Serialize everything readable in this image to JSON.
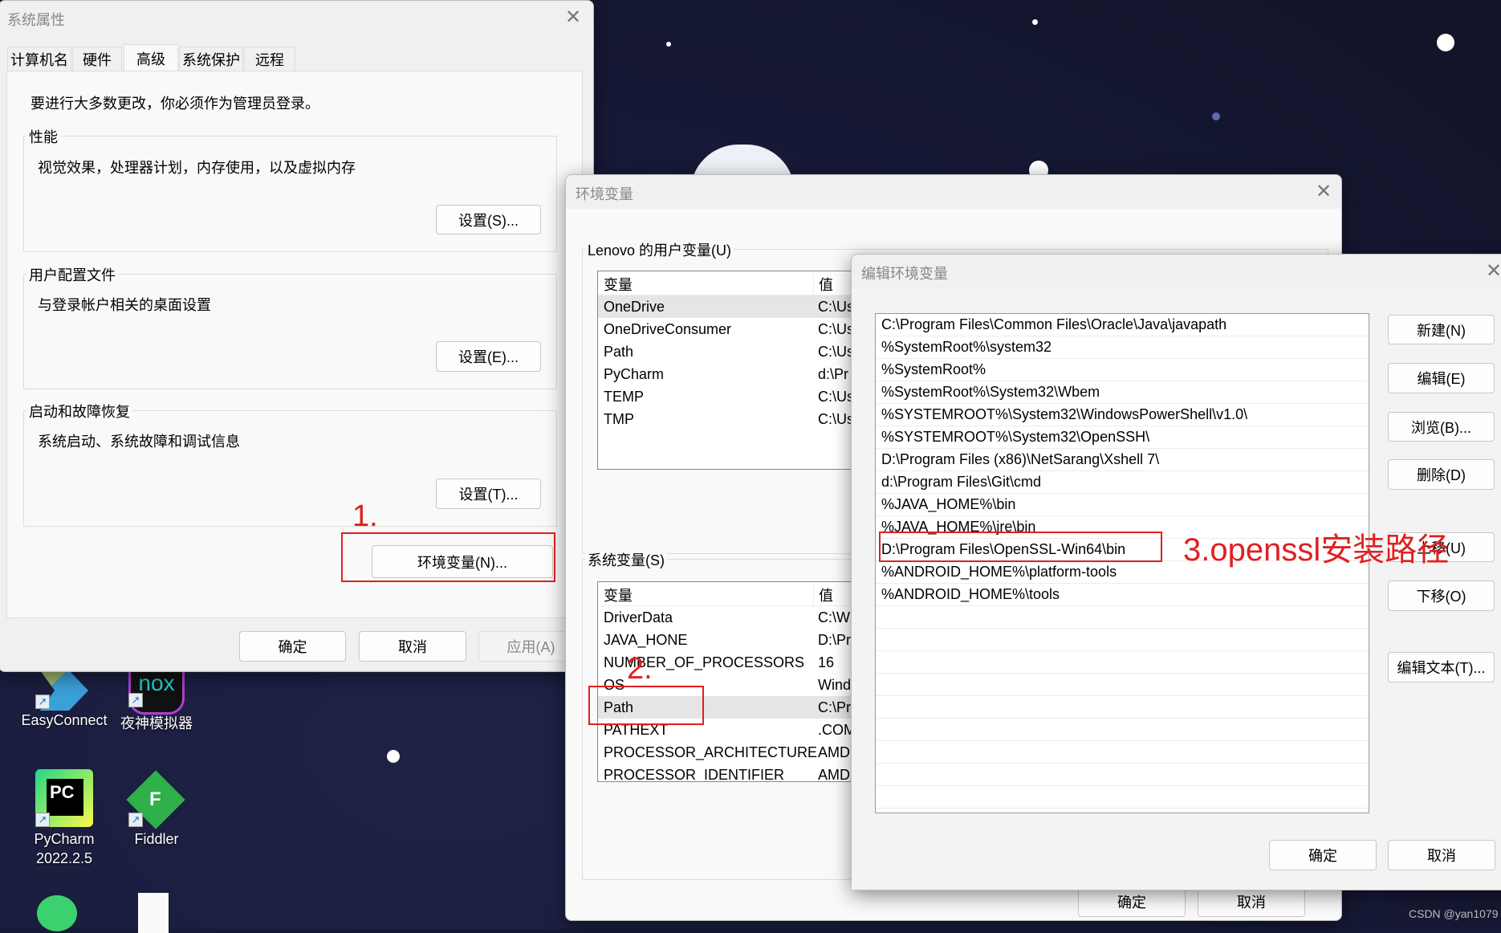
{
  "watermark": "CSDN @yan1079",
  "desktop": {
    "icons": [
      {
        "label": "EasyConnect"
      },
      {
        "label": "夜神模拟器",
        "logo": "nox"
      },
      {
        "label": "PyCharm\n2022.2.5",
        "label1": "PyCharm",
        "label2": "2022.2.5",
        "logo": "PC"
      },
      {
        "label": "Fiddler",
        "logo": "F"
      }
    ]
  },
  "system_properties": {
    "title": "系统属性",
    "tabs": [
      "计算机名",
      "硬件",
      "高级",
      "系统保护",
      "远程"
    ],
    "selected_tab": "高级",
    "notice": "要进行大多数更改，你必须作为管理员登录。",
    "groups": [
      {
        "label": "性能",
        "desc": "视觉效果，处理器计划，内存使用，以及虚拟内存",
        "button": "设置(S)..."
      },
      {
        "label": "用户配置文件",
        "desc": "与登录帐户相关的桌面设置",
        "button": "设置(E)..."
      },
      {
        "label": "启动和故障恢复",
        "desc": "系统启动、系统故障和调试信息",
        "button": "设置(T)..."
      }
    ],
    "env_button": "环境变量(N)...",
    "ok": "确定",
    "cancel": "取消",
    "apply": "应用(A)"
  },
  "environment_variables": {
    "title": "环境变量",
    "user_group": "Lenovo 的用户变量(U)",
    "system_group": "系统变量(S)",
    "col_var": "变量",
    "col_val": "值",
    "user_vars": [
      {
        "name": "OneDrive",
        "value": "C:\\Us"
      },
      {
        "name": "OneDriveConsumer",
        "value": "C:\\Us"
      },
      {
        "name": "Path",
        "value": "C:\\Us"
      },
      {
        "name": "PyCharm",
        "value": "d:\\Pr"
      },
      {
        "name": "TEMP",
        "value": "C:\\Us"
      },
      {
        "name": "TMP",
        "value": "C:\\Us"
      }
    ],
    "system_vars": [
      {
        "name": "DriverData",
        "value": "C:\\Wi"
      },
      {
        "name": "JAVA_HONE",
        "value": "D:\\Pr"
      },
      {
        "name": "NUMBER_OF_PROCESSORS",
        "value": "16"
      },
      {
        "name": "OS",
        "value": "Wind"
      },
      {
        "name": "Path",
        "value": "C:\\Pr"
      },
      {
        "name": "PATHEXT",
        "value": ".COM"
      },
      {
        "name": "PROCESSOR_ARCHITECTURE",
        "value": "AMD"
      },
      {
        "name": "PROCESSOR_IDENTIFIER",
        "value": "AMD"
      }
    ],
    "ok": "确定",
    "cancel": "取消"
  },
  "edit_env": {
    "title": "编辑环境变量",
    "entries": [
      "C:\\Program Files\\Common Files\\Oracle\\Java\\javapath",
      "%SystemRoot%\\system32",
      "%SystemRoot%",
      "%SystemRoot%\\System32\\Wbem",
      "%SYSTEMROOT%\\System32\\WindowsPowerShell\\v1.0\\",
      "%SYSTEMROOT%\\System32\\OpenSSH\\",
      "D:\\Program Files (x86)\\NetSarang\\Xshell 7\\",
      "d:\\Program Files\\Git\\cmd",
      "%JAVA_HOME%\\bin",
      "%JAVA_HOME%\\jre\\bin",
      "D:\\Program Files\\OpenSSL-Win64\\bin",
      "%ANDROID_HOME%\\platform-tools",
      "%ANDROID_HOME%\\tools"
    ],
    "buttons": {
      "new": "新建(N)",
      "edit": "编辑(E)",
      "browse": "浏览(B)...",
      "delete": "删除(D)",
      "up": "上移(U)",
      "down": "下移(O)",
      "edit_text": "编辑文本(T)..."
    },
    "ok": "确定",
    "cancel": "取消"
  },
  "annotations": {
    "step1": "1.",
    "step2": "2.",
    "step3": "3.openssl安装路径",
    "color": "#e02020"
  }
}
